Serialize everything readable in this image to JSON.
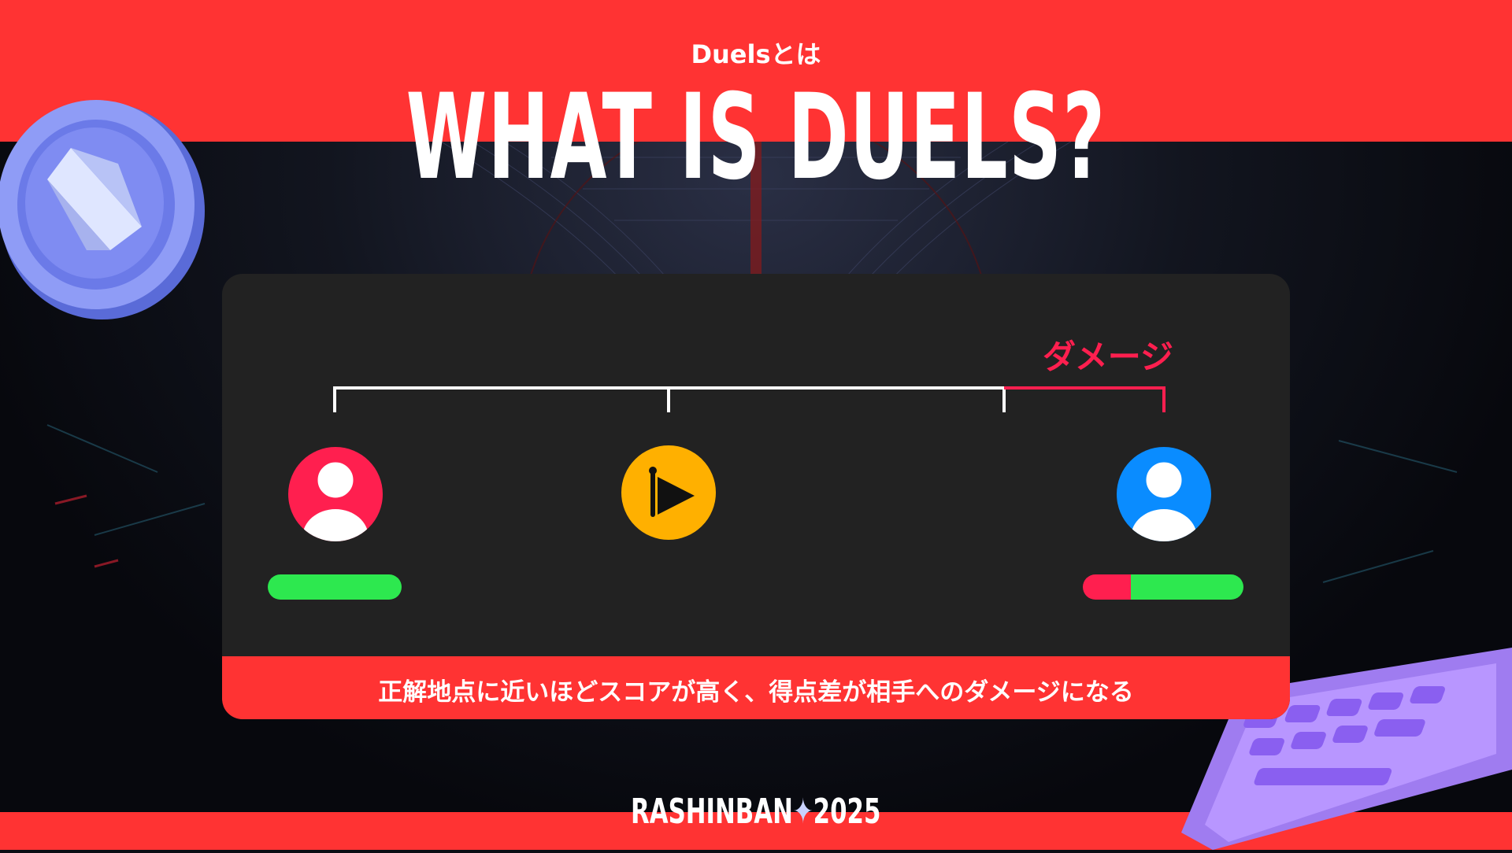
{
  "header": {
    "subtitle": "Duelsとは",
    "title": "WHAT IS DUELS?"
  },
  "diagram": {
    "damage_label": "ダメージ",
    "caption": "正解地点に近いほどスコアが高く、得点差が相手へのダメージになる",
    "players": [
      {
        "name": "player-red",
        "color": "#ff1f4f",
        "health": 1.0
      },
      {
        "name": "player-blue",
        "color": "#0a8cff",
        "health": 0.7
      }
    ],
    "goal_color": "#ffb000"
  },
  "footer": {
    "logo_left": "RASHINBAN",
    "logo_right": "2025"
  },
  "colors": {
    "accent": "#ff3333",
    "panel": "#222222",
    "damage": "#ff1f4f",
    "health": "#2de84f"
  }
}
